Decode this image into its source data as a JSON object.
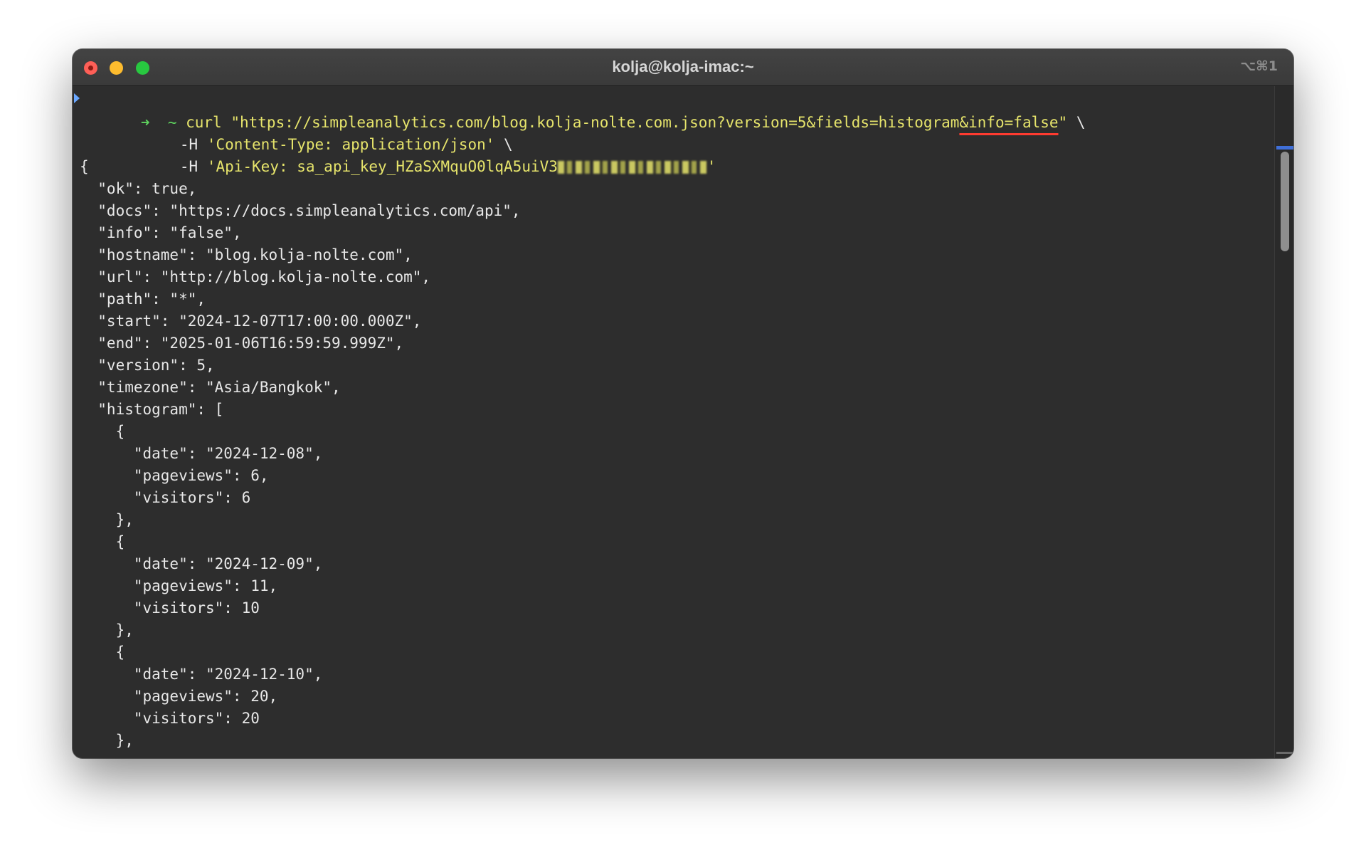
{
  "window": {
    "title": "kolja@kolja-imac:~",
    "shortcut": "⌥⌘1"
  },
  "terminal": {
    "prompt_arrow": "➜",
    "prompt_dir": "~",
    "command": "curl",
    "url_start": "\"https://simpleanalytics.com/blog.kolja-nolte.com.json?version=5&fields=histogram",
    "url_highlight": "&info=false",
    "url_end": "\"",
    "line_continuation": "\\",
    "header_flag": "-H",
    "header_content_type": "'Content-Type: application/json'",
    "header_api_key_prefix": "'Api-Key: sa_api_key_HZaSXMquO0lqA5uiV3",
    "header_api_key_suffix": "'",
    "output_lines": [
      "{",
      "  \"ok\": true,",
      "  \"docs\": \"https://docs.simpleanalytics.com/api\",",
      "  \"info\": \"false\",",
      "  \"hostname\": \"blog.kolja-nolte.com\",",
      "  \"url\": \"http://blog.kolja-nolte.com\",",
      "  \"path\": \"*\",",
      "  \"start\": \"2024-12-07T17:00:00.000Z\",",
      "  \"end\": \"2025-01-06T16:59:59.999Z\",",
      "  \"version\": 5,",
      "  \"timezone\": \"Asia/Bangkok\",",
      "  \"histogram\": [",
      "    {",
      "      \"date\": \"2024-12-08\",",
      "      \"pageviews\": 6,",
      "      \"visitors\": 6",
      "    },",
      "    {",
      "      \"date\": \"2024-12-09\",",
      "      \"pageviews\": 11,",
      "      \"visitors\": 10",
      "    },",
      "    {",
      "      \"date\": \"2024-12-10\",",
      "      \"pageviews\": 20,",
      "      \"visitors\": 20",
      "    },"
    ]
  },
  "colors": {
    "background": "#2d2d2d",
    "string": "#e6e46b",
    "prompt": "#5fd45f",
    "underline": "#ff3b30"
  }
}
